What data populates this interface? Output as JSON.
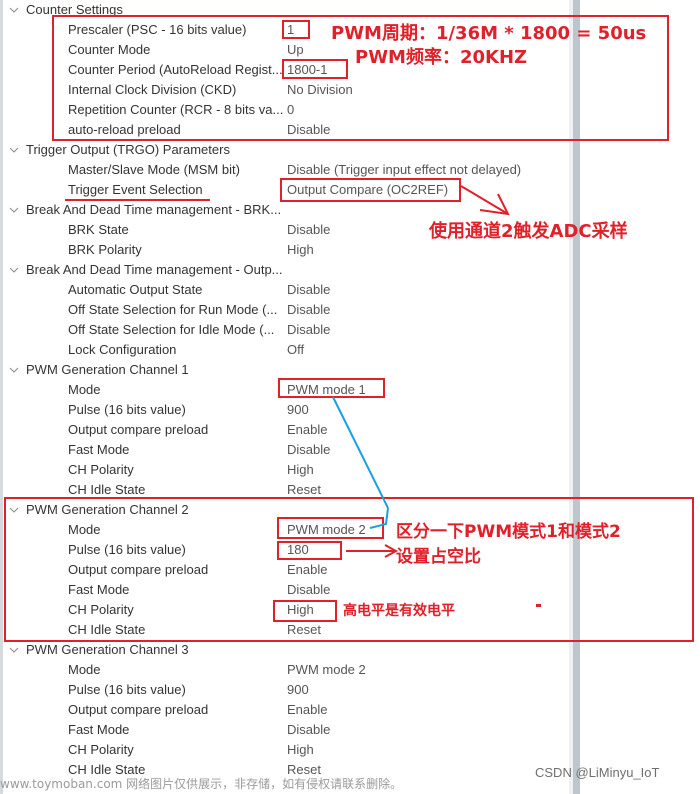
{
  "sections": [
    {
      "title": "Counter Settings",
      "items": [
        {
          "label": "Prescaler (PSC - 16 bits value)",
          "value": "1"
        },
        {
          "label": "Counter Mode",
          "value": "Up"
        },
        {
          "label": "Counter Period (AutoReload Regist...",
          "value": "1800-1"
        },
        {
          "label": "Internal Clock Division (CKD)",
          "value": "No Division"
        },
        {
          "label": "Repetition Counter (RCR - 8 bits va...",
          "value": "0"
        },
        {
          "label": "auto-reload preload",
          "value": "Disable"
        }
      ]
    },
    {
      "title": "Trigger Output (TRGO) Parameters",
      "items": [
        {
          "label": "Master/Slave Mode (MSM bit)",
          "value": "Disable (Trigger input effect not delayed)"
        },
        {
          "label": "Trigger Event Selection",
          "value": "Output Compare (OC2REF)"
        }
      ]
    },
    {
      "title": "Break And Dead Time management - BRK...",
      "items": [
        {
          "label": "BRK State",
          "value": "Disable"
        },
        {
          "label": "BRK Polarity",
          "value": "High"
        }
      ]
    },
    {
      "title": "Break And Dead Time management - Outp...",
      "items": [
        {
          "label": "Automatic Output State",
          "value": "Disable"
        },
        {
          "label": "Off State Selection for Run Mode (...",
          "value": "Disable"
        },
        {
          "label": "Off State Selection for Idle Mode (...",
          "value": "Disable"
        },
        {
          "label": "Lock Configuration",
          "value": "Off"
        }
      ]
    },
    {
      "title": "PWM Generation Channel 1",
      "items": [
        {
          "label": "Mode",
          "value": "PWM mode 1"
        },
        {
          "label": "Pulse (16 bits value)",
          "value": "900"
        },
        {
          "label": "Output compare preload",
          "value": "Enable"
        },
        {
          "label": "Fast Mode",
          "value": "Disable"
        },
        {
          "label": "CH Polarity",
          "value": "High"
        },
        {
          "label": "CH Idle State",
          "value": "Reset"
        }
      ]
    },
    {
      "title": "PWM Generation Channel 2",
      "items": [
        {
          "label": "Mode",
          "value": "PWM mode 2"
        },
        {
          "label": "Pulse (16 bits value)",
          "value": "180"
        },
        {
          "label": "Output compare preload",
          "value": "Enable"
        },
        {
          "label": "Fast Mode",
          "value": "Disable"
        },
        {
          "label": "CH Polarity",
          "value": "High"
        },
        {
          "label": "CH Idle State",
          "value": "Reset"
        }
      ]
    },
    {
      "title": "PWM Generation Channel 3",
      "items": [
        {
          "label": "Mode",
          "value": "PWM mode 2"
        },
        {
          "label": "Pulse (16 bits value)",
          "value": "900"
        },
        {
          "label": "Output compare preload",
          "value": "Enable"
        },
        {
          "label": "Fast Mode",
          "value": "Disable"
        },
        {
          "label": "CH Polarity",
          "value": "High"
        },
        {
          "label": "CH Idle State",
          "value": "Reset"
        }
      ]
    }
  ],
  "annotations": {
    "pwm_period": "PWM周期：1/36M * 1800 = 50us",
    "pwm_freq": "PWM频率：20KHZ",
    "trigger_note": "使用通道2触发ADC采样",
    "mode_note": "区分一下PWM模式1和模式2",
    "duty_note": "设置占空比",
    "polarity_note": "高电平是有效电平"
  },
  "footer": {
    "watermark": "www.toymoban.com 网络图片仅供展示，非存储，如有侵权请联系删除。",
    "credit": "CSDN @LiMinyu_IoT"
  },
  "colors": {
    "annotation_red": "#e0202a",
    "arrow_blue": "#1a9fe0",
    "scroll_thumb": "#bcc6cc"
  }
}
